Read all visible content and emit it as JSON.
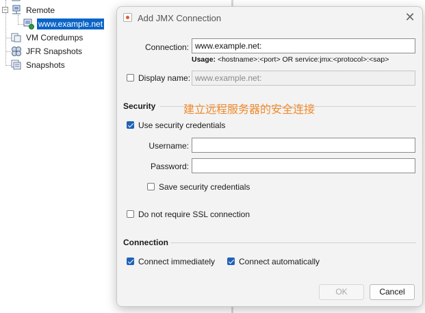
{
  "tree": {
    "items": [
      {
        "label": "Remote"
      },
      {
        "label": "www.example.net"
      },
      {
        "label": "VM Coredumps"
      },
      {
        "label": "JFR Snapshots"
      },
      {
        "label": "Snapshots"
      }
    ]
  },
  "dialog": {
    "title": "Add JMX Connection",
    "close_glyph": "✕",
    "connection_label": "Connection:",
    "connection_value": "www.example.net:",
    "usage_prefix": "Usage:",
    "usage_text": "<hostname>:<port> OR service:jmx:<protocol>:<sap>",
    "display_name_label": "Display name:",
    "display_name_value": "www.example.net:",
    "display_name_checked": false,
    "security_title": "Security",
    "overlay_text": "建立远程服务器的安全连接",
    "use_security_label": "Use security credentials",
    "use_security_checked": true,
    "username_label": "Username:",
    "username_value": "",
    "password_label": "Password:",
    "password_value": "",
    "save_credentials_label": "Save security credentials",
    "save_credentials_checked": false,
    "no_ssl_label": "Do not require SSL connection",
    "no_ssl_checked": false,
    "connection_section_title": "Connection",
    "connect_immediately_label": "Connect immediately",
    "connect_immediately_checked": true,
    "connect_automatically_label": "Connect automatically",
    "connect_automatically_checked": true,
    "ok_label": "OK",
    "cancel_label": "Cancel"
  },
  "colors": {
    "selection": "#0a64c8",
    "checkbox_checked": "#1f62b8",
    "overlay_text": "#f08a2b"
  }
}
